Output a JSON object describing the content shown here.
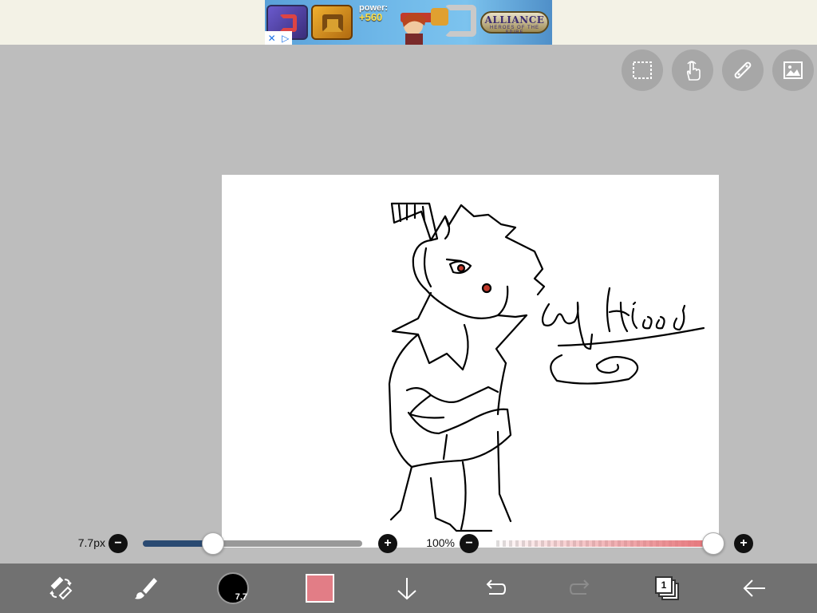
{
  "ad": {
    "power_label": "power:",
    "power_value": "+560",
    "brand_title": "ALLIANCE",
    "brand_subtitle": "HEROES OF THE SPIRE"
  },
  "top_tools": [
    {
      "name": "selection-tool-button",
      "icon": "dashed-selection-icon"
    },
    {
      "name": "hand-gesture-button",
      "icon": "touch-hand-icon"
    },
    {
      "name": "ruler-button",
      "icon": "ruler-pen-icon"
    },
    {
      "name": "material-button",
      "icon": "image-icon"
    }
  ],
  "brush": {
    "size_label": "7.7px",
    "size_badge": "7.7",
    "size_fraction": 0.32
  },
  "opacity": {
    "label": "100%",
    "fraction": 1.0,
    "color": "#e27d86"
  },
  "toolbar": {
    "layer_count": "1"
  },
  "colors": {
    "background": "#bdbdbd",
    "toolbar": "#717171",
    "size_fill": "#2a4a72",
    "current_color": "#e27d86"
  }
}
